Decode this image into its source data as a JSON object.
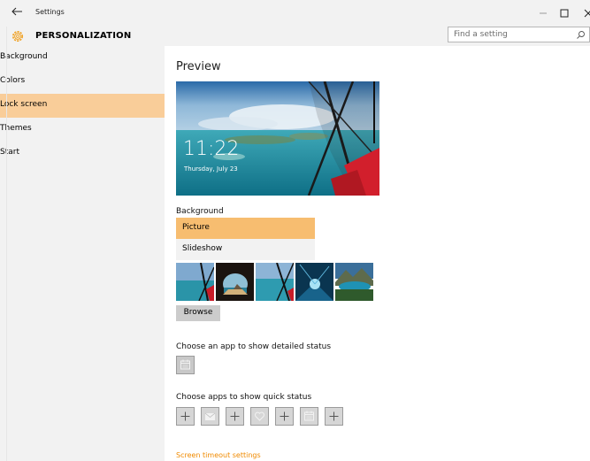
{
  "window": {
    "title": "Settings",
    "controls": [
      "minimize",
      "maximize",
      "close"
    ]
  },
  "header": {
    "section_title": "PERSONALIZATION",
    "search_placeholder": "Find a setting"
  },
  "sidebar": {
    "items": [
      {
        "label": "Background",
        "active": false
      },
      {
        "label": "Colors",
        "active": false
      },
      {
        "label": "Lock screen",
        "active": true
      },
      {
        "label": "Themes",
        "active": false
      },
      {
        "label": "Start",
        "active": false
      }
    ]
  },
  "main": {
    "preview_title": "Preview",
    "preview_time": "11:22",
    "preview_date": "Thursday, July 23",
    "background_label": "Background",
    "background_options": [
      {
        "label": "Picture",
        "selected": true
      },
      {
        "label": "Slideshow",
        "selected": false
      }
    ],
    "browse_label": "Browse",
    "detail_status_label": "Choose an app to show detailed status",
    "quick_status_label": "Choose apps to show quick status",
    "quick_status_slots": [
      "add",
      "mail-icon",
      "add",
      "heart-icon",
      "add",
      "calendar-icon",
      "add"
    ],
    "timeout_link": "Screen timeout settings"
  },
  "colors": {
    "accent": "#f08a00",
    "selected_bg": "#f7bd70",
    "active_nav": "#f9cd99",
    "chrome": "#f2f2f2"
  }
}
